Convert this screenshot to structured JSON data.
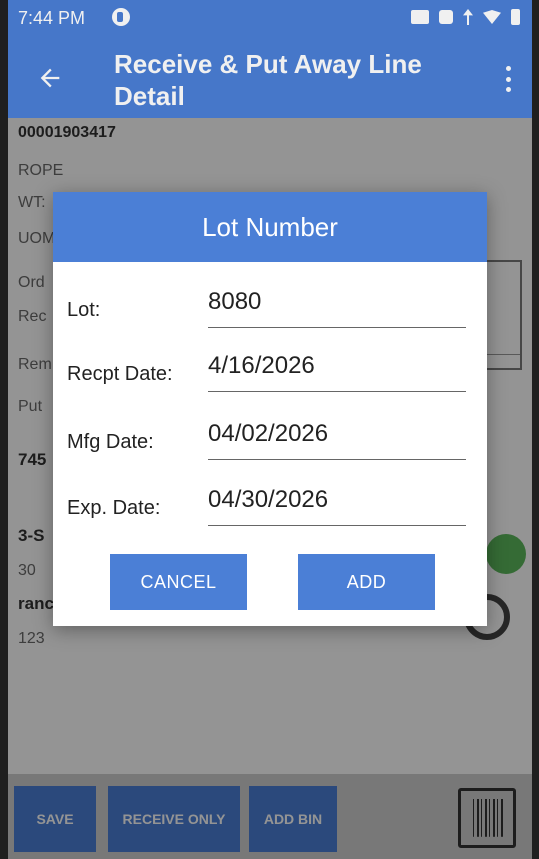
{
  "status_bar": {
    "time": "7:44 PM",
    "icons": [
      "app-icon",
      "cast-icon",
      "vibrate-icon",
      "data-icon",
      "wifi-icon",
      "battery-icon"
    ]
  },
  "app_bar": {
    "title": "Receive & Put Away Line Detail",
    "back_icon": "arrow-left-icon",
    "menu_icon": "more-vert-icon"
  },
  "background": {
    "item_number": "00001903417",
    "description": "ROPE",
    "wt_label": "WT:",
    "uom_label": "UOM",
    "ord_label": "Ord",
    "rec_label": "Rec",
    "rem_label": "Rem",
    "put_label": "Put",
    "put_value": "745",
    "bin_code": "3-S",
    "bin_qty": "30",
    "lot_label": "ranc",
    "lot_qty": "123"
  },
  "bottom_bar": {
    "save_label": "SAVE",
    "receive_only_label": "RECEIVE ONLY",
    "add_bin_label": "ADD BIN",
    "barcode_icon": "barcode-icon"
  },
  "dialog": {
    "title": "Lot Number",
    "fields": [
      {
        "label": "Lot:",
        "value": "8080"
      },
      {
        "label": "Recpt Date:",
        "value": "4/16/2026"
      },
      {
        "label": "Mfg Date:",
        "value": "04/02/2026"
      },
      {
        "label": "Exp. Date:",
        "value": "04/30/2026"
      }
    ],
    "cancel_label": "CANCEL",
    "add_label": "ADD"
  },
  "colors": {
    "primary": "#4b7fd6",
    "toggle_on": "#5cb85c",
    "scrim": "rgba(0,0,0,0.42)"
  }
}
